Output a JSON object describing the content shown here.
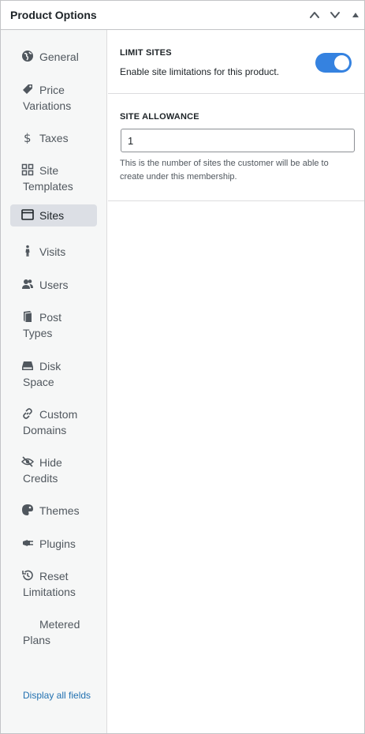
{
  "header": {
    "title": "Product Options"
  },
  "sidebar": {
    "items": [
      {
        "label": "General",
        "icon": "globe-icon"
      },
      {
        "label": "Price Variations",
        "icon": "price-tag-icon"
      },
      {
        "label": "Taxes",
        "icon": "dollar-icon"
      },
      {
        "label": "Site Templates",
        "icon": "grid-icon"
      },
      {
        "label": "Sites",
        "icon": "browser-window-icon",
        "active": true
      },
      {
        "label": "Visits",
        "icon": "walking-person-icon"
      },
      {
        "label": "Users",
        "icon": "users-icon"
      },
      {
        "label": "Post Types",
        "icon": "book-icon"
      },
      {
        "label": "Disk Space",
        "icon": "drive-icon"
      },
      {
        "label": "Custom Domains",
        "icon": "link-icon"
      },
      {
        "label": "Hide Credits",
        "icon": "eye-slash-icon"
      },
      {
        "label": "Themes",
        "icon": "palette-icon"
      },
      {
        "label": "Plugins",
        "icon": "plug-icon"
      },
      {
        "label": "Reset Limitations",
        "icon": "history-icon"
      },
      {
        "label": "Metered Plans",
        "icon": ""
      }
    ],
    "display_all": "Display all fields"
  },
  "main": {
    "limit_sites": {
      "label": "LIMIT SITES",
      "description": "Enable site limitations for this product.",
      "enabled": true
    },
    "site_allowance": {
      "label": "SITE ALLOWANCE",
      "value": "1",
      "help": "This is the number of sites the customer will be able to create under this membership."
    }
  },
  "colors": {
    "accent": "#3582e0",
    "link": "#2271b1",
    "sidebar_bg": "#f6f7f7",
    "active_bg": "#dcdfe5"
  }
}
